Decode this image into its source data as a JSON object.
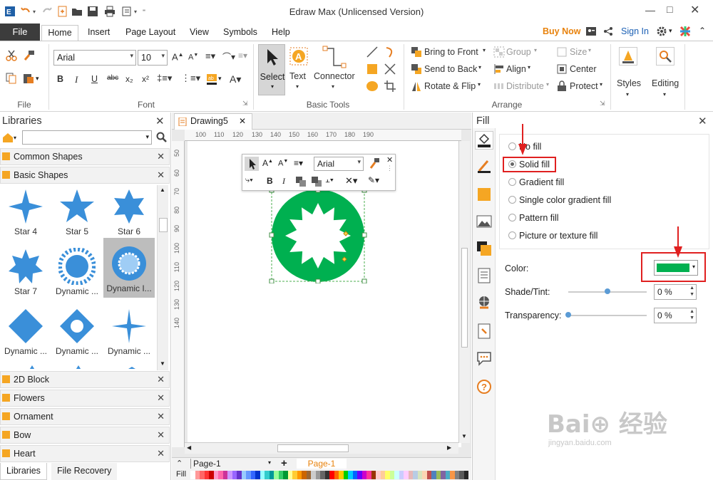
{
  "window": {
    "title": "Edraw Max (Unlicensed Version)"
  },
  "menu": {
    "file": "File",
    "home": "Home",
    "insert": "Insert",
    "page_layout": "Page Layout",
    "view": "View",
    "symbols": "Symbols",
    "help": "Help",
    "buy_now": "Buy Now",
    "sign_in": "Sign In"
  },
  "ribbon": {
    "font_name": "Arial",
    "font_size": "10",
    "groups": {
      "file": "File",
      "font": "Font",
      "basic_tools": "Basic Tools",
      "arrange": "Arrange"
    },
    "tools": {
      "select": "Select",
      "text": "Text",
      "connector": "Connector"
    },
    "arrange": {
      "bring_to_front": "Bring to Front",
      "send_to_back": "Send to Back",
      "rotate_flip": "Rotate & Flip",
      "group": "Group",
      "align": "Align",
      "distribute": "Distribute",
      "size": "Size",
      "center": "Center",
      "protect": "Protect"
    },
    "styles": "Styles",
    "editing": "Editing"
  },
  "libraries": {
    "title": "Libraries",
    "search_value": "",
    "sections": [
      "Common Shapes",
      "Basic Shapes",
      "2D Block",
      "Flowers",
      "Ornament",
      "Bow",
      "Heart"
    ],
    "shapes": [
      "Star 4",
      "Star 5",
      "Star 6",
      "Star 7",
      "Dynamic ...",
      "Dynamic I...",
      "Dynamic ...",
      "Dynamic ...",
      "Dynamic ..."
    ],
    "bottom_tabs": [
      "Libraries",
      "File Recovery"
    ]
  },
  "canvas": {
    "doc_tab": "Drawing5",
    "ruler_h": [
      "100",
      "110",
      "120",
      "130",
      "140",
      "150",
      "160",
      "170",
      "180",
      "190"
    ],
    "ruler_v": [
      "50",
      "60",
      "70",
      "80",
      "90",
      "100",
      "110",
      "120",
      "130",
      "140"
    ],
    "float_font": "Arial",
    "page_select": "Page-1",
    "page_tab": "Page-1",
    "fill_label": "Fill"
  },
  "shape_colors": {
    "fill": "#00b050",
    "shape": "#3a8fd9"
  },
  "fill_panel": {
    "title": "Fill",
    "options": [
      "No fill",
      "Solid fill",
      "Gradient fill",
      "Single color gradient fill",
      "Pattern fill",
      "Picture or texture fill"
    ],
    "selected_option": "Solid fill",
    "color_label": "Color:",
    "shade_label": "Shade/Tint:",
    "shade_value": "0 %",
    "shade_level": 0.5,
    "transparency_label": "Transparency:",
    "transparency_value": "0 %",
    "transparency_level": 0,
    "selected_color": "#00b050"
  },
  "palette": [
    "#ffffff",
    "#ff9999",
    "#ff6666",
    "#ff3333",
    "#cc0000",
    "#ff99cc",
    "#ff66aa",
    "#cc3399",
    "#cc99ff",
    "#9966ff",
    "#6633cc",
    "#99ccff",
    "#6699ff",
    "#3366ff",
    "#0033cc",
    "#99ffff",
    "#33cccc",
    "#009999",
    "#99ff99",
    "#33cc66",
    "#009933",
    "#ffff99",
    "#ffcc33",
    "#ff9900",
    "#cc6600",
    "#996633",
    "#cccccc",
    "#999999",
    "#666666",
    "#333333",
    "#ff0000",
    "#ff6600",
    "#ffcc00",
    "#00cc00",
    "#00ccff",
    "#0066ff",
    "#6600ff",
    "#cc00cc",
    "#ff3399",
    "#993300",
    "#ffcccc",
    "#ffcc99",
    "#ffff66",
    "#ccff99",
    "#ccffff",
    "#ccccff",
    "#ffccff",
    "#e6b8b7",
    "#b8cce4",
    "#d7e4bd",
    "#fcd5b4",
    "#c0504d",
    "#4f81bd",
    "#9bbb59",
    "#8064a2",
    "#4bacc6",
    "#f79646",
    "#7f7f7f",
    "#595959",
    "#262626"
  ]
}
